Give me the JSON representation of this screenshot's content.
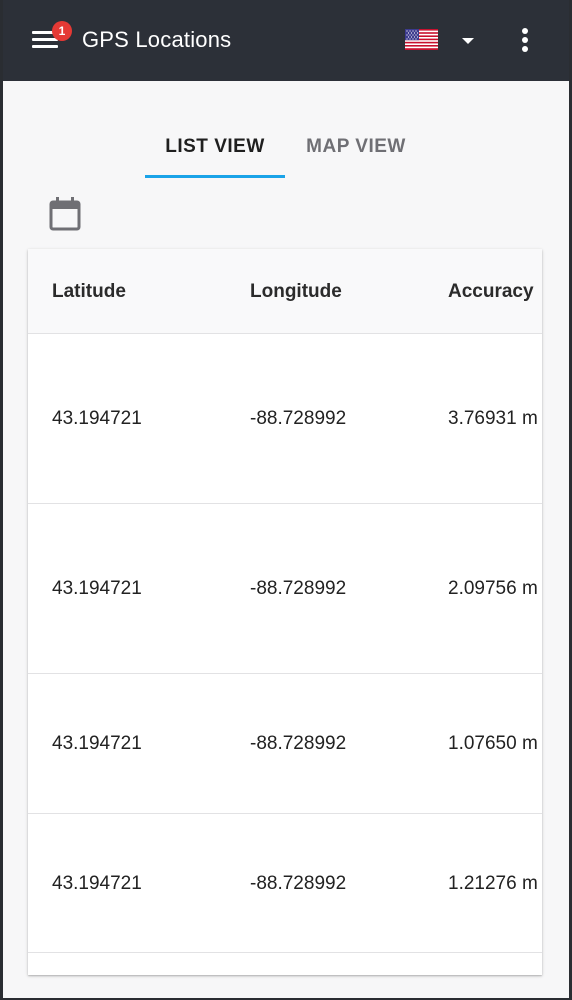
{
  "app": {
    "title": "GPS Locations",
    "notification_count": "1",
    "language_flag": "us-flag-icon"
  },
  "tabs": [
    {
      "label": "LIST VIEW",
      "active": true
    },
    {
      "label": "MAP VIEW",
      "active": false
    }
  ],
  "colors": {
    "appbar": "#2c3038",
    "tab_indicator": "#1aa3e8",
    "badge": "#e53935",
    "background": "#f7f7f8"
  },
  "table": {
    "columns": [
      "Latitude",
      "Longitude",
      "Accuracy"
    ],
    "rows": [
      {
        "latitude": "43.194721",
        "longitude": "-88.728992",
        "accuracy": "3.76931 m"
      },
      {
        "latitude": "43.194721",
        "longitude": "-88.728992",
        "accuracy": "2.09756 m"
      },
      {
        "latitude": "43.194721",
        "longitude": "-88.728992",
        "accuracy": "1.07650 m"
      },
      {
        "latitude": "43.194721",
        "longitude": "-88.728992",
        "accuracy": "1.21276 m"
      }
    ]
  }
}
